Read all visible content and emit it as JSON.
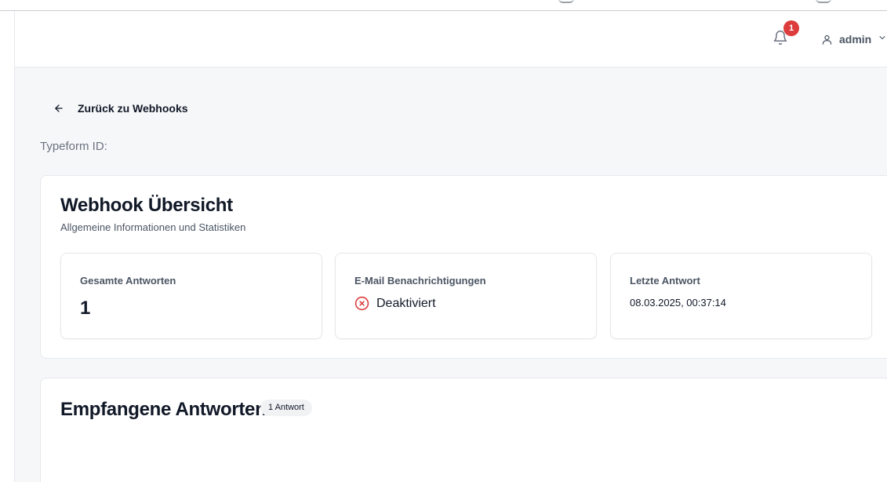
{
  "header": {
    "notification_count": "1",
    "user_name": "admin"
  },
  "back_link": {
    "label": "Zurück zu Webhooks"
  },
  "typeform_id_label": "Typeform ID:",
  "overview": {
    "title": "Webhook Übersicht",
    "subtitle": "Allgemeine Informationen und Statistiken",
    "stats": {
      "total": {
        "label": "Gesamte Antworten",
        "value": "1"
      },
      "email": {
        "label": "E-Mail Benachrichtigungen",
        "status": "Deaktiviert",
        "status_color": "#dc3c3c"
      },
      "last": {
        "label": "Letzte Antwort",
        "value": "08.03.2025, 00:37:14"
      }
    }
  },
  "responses": {
    "title": "Empfangene Antworten",
    "count_label": "1 Antwort"
  },
  "icons": {
    "bell": "bell-icon",
    "user": "user-icon",
    "chevron": "chevron-down-icon",
    "back": "arrow-left-icon",
    "status": "x-circle-icon"
  },
  "colors": {
    "badge": "#dc3c3c",
    "background": "#f6f7f9",
    "card": "#ffffff"
  }
}
